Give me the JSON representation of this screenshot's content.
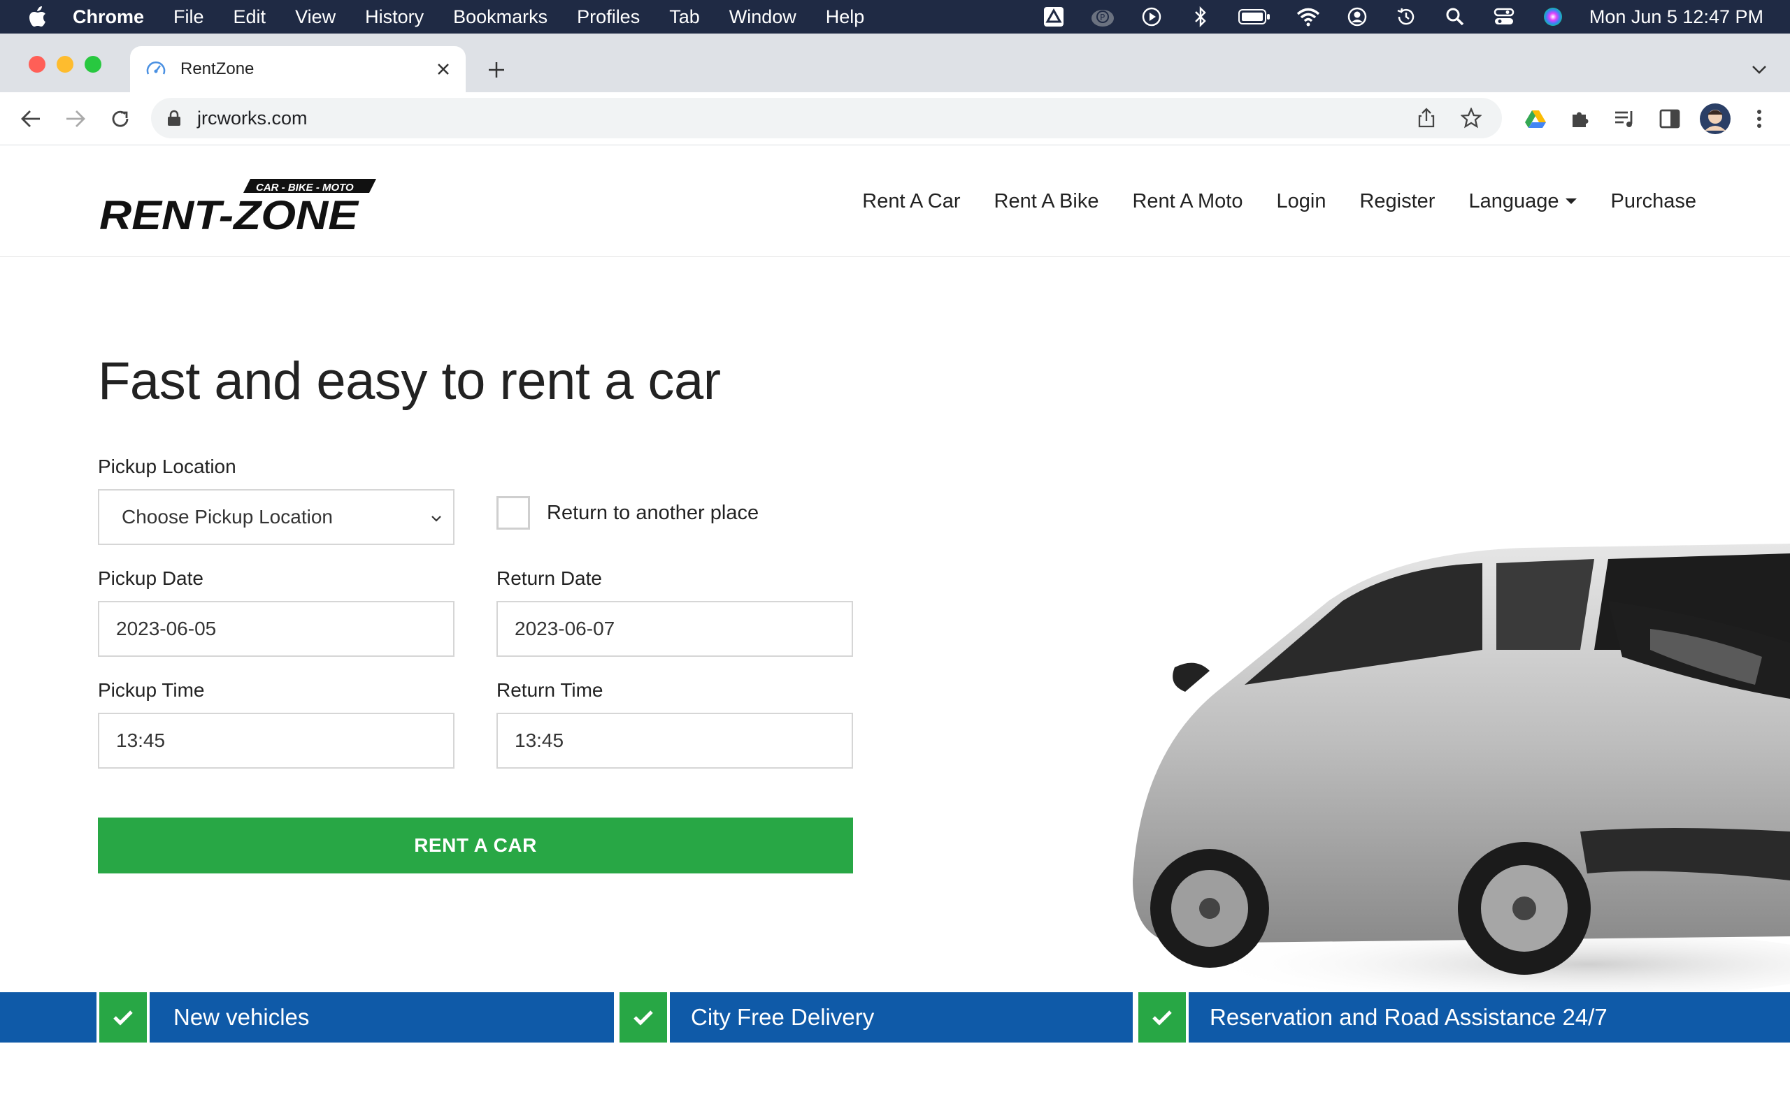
{
  "menubar": {
    "app_name": "Chrome",
    "items": [
      "File",
      "Edit",
      "View",
      "History",
      "Bookmarks",
      "Profiles",
      "Tab",
      "Window",
      "Help"
    ],
    "clock": "Mon Jun 5  12:47 PM"
  },
  "browser": {
    "tab_title": "RentZone",
    "url": "jrcworks.com"
  },
  "site": {
    "logo_tagline": "CAR - BIKE - MOTO",
    "logo_text": "RENT-ZONE",
    "nav": [
      "Rent A Car",
      "Rent A Bike",
      "Rent A Moto",
      "Login",
      "Register",
      "Language",
      "Purchase"
    ],
    "hero_title": "Fast and easy to rent a car"
  },
  "form": {
    "pickup_location_label": "Pickup Location",
    "pickup_location_value": "Choose Pickup Location",
    "return_other_label": "Return to another place",
    "return_other_checked": false,
    "pickup_date_label": "Pickup Date",
    "pickup_date_value": "2023-06-05",
    "return_date_label": "Return Date",
    "return_date_value": "2023-06-07",
    "pickup_time_label": "Pickup Time",
    "pickup_time_value": "13:45",
    "return_time_label": "Return Time",
    "return_time_value": "13:45",
    "submit_label": "RENT A CAR"
  },
  "features": [
    "New vehicles",
    "City Free Delivery",
    "Reservation and Road Assistance 24/7"
  ],
  "colors": {
    "accent_green": "#28a745",
    "feature_blue": "#0f5aa8",
    "menubar_bg": "#1f2a44"
  }
}
